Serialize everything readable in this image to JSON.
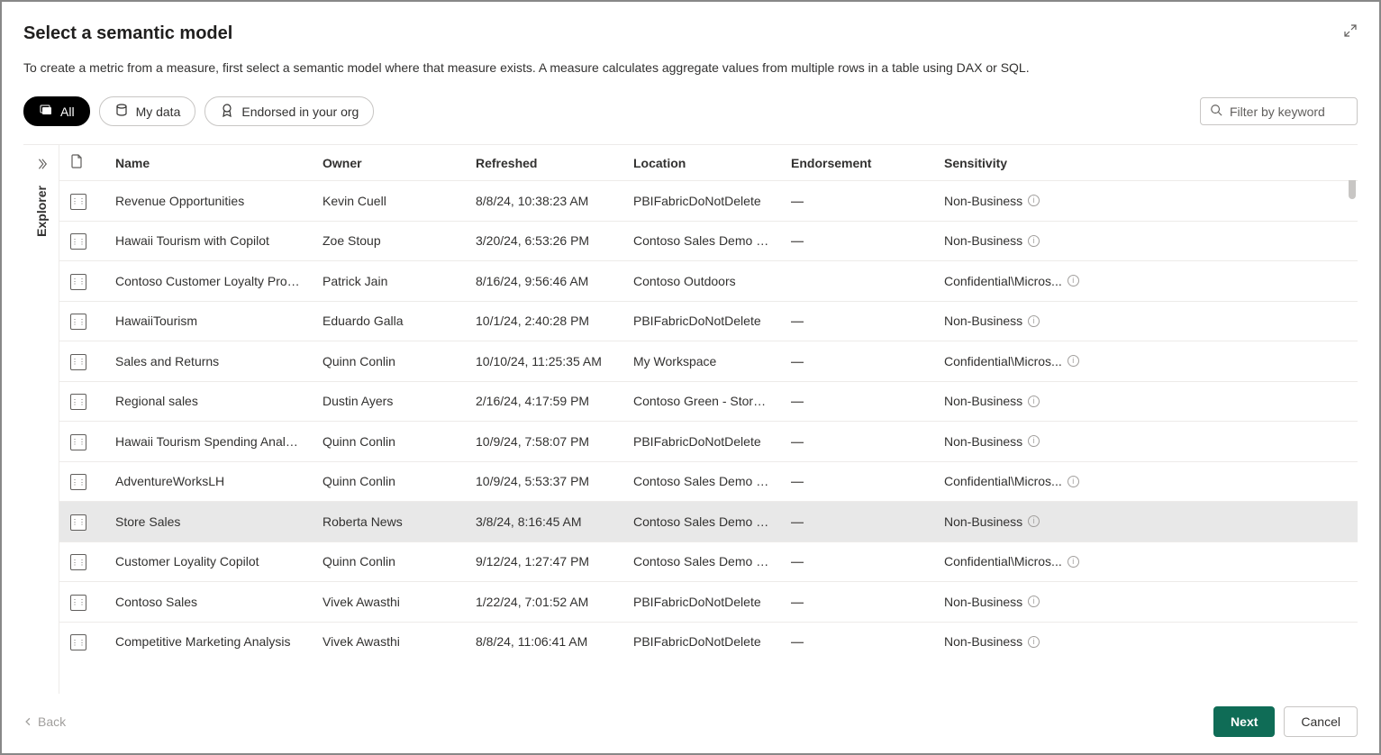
{
  "header": {
    "title": "Select a semantic model",
    "description": "To create a metric from a measure, first select a semantic model where that measure exists. A measure calculates aggregate values from multiple rows in a table using DAX or SQL."
  },
  "filters": {
    "all": "All",
    "my_data": "My data",
    "endorsed": "Endorsed in your org"
  },
  "search": {
    "placeholder": "Filter by keyword"
  },
  "side": {
    "label": "Explorer"
  },
  "columns": {
    "name": "Name",
    "owner": "Owner",
    "refreshed": "Refreshed",
    "location": "Location",
    "endorsement": "Endorsement",
    "sensitivity": "Sensitivity"
  },
  "rows": [
    {
      "name": "Revenue Opportunities",
      "owner": "Kevin Cuell",
      "refreshed": "8/8/24, 10:38:23 AM",
      "location": "PBIFabricDoNotDelete",
      "endorsement": "—",
      "sensitivity": "Non-Business",
      "selected": false
    },
    {
      "name": "Hawaii Tourism with Copilot",
      "owner": "Zoe Stoup",
      "refreshed": "3/20/24, 6:53:26 PM",
      "location": "Contoso Sales Demo Sp...",
      "endorsement": "—",
      "sensitivity": "Non-Business",
      "selected": false
    },
    {
      "name": "Contoso Customer Loyalty Progr...",
      "owner": "Patrick Jain",
      "refreshed": "8/16/24, 9:56:46 AM",
      "location": "Contoso Outdoors",
      "endorsement": "",
      "sensitivity": "Confidential\\Micros...",
      "selected": false
    },
    {
      "name": "HawaiiTourism",
      "owner": "Eduardo Galla",
      "refreshed": "10/1/24, 2:40:28 PM",
      "location": "PBIFabricDoNotDelete",
      "endorsement": "—",
      "sensitivity": "Non-Business",
      "selected": false
    },
    {
      "name": "Sales and Returns",
      "owner": "Quinn Conlin",
      "refreshed": "10/10/24, 11:25:35 AM",
      "location": "My Workspace",
      "endorsement": "—",
      "sensitivity": "Confidential\\Micros...",
      "selected": false
    },
    {
      "name": "Regional sales",
      "owner": "Dustin Ayers",
      "refreshed": "2/16/24, 4:17:59 PM",
      "location": "Contoso Green - Stores ...",
      "endorsement": "—",
      "sensitivity": "Non-Business",
      "selected": false
    },
    {
      "name": "Hawaii Tourism Spending Analysis",
      "owner": "Quinn Conlin",
      "refreshed": "10/9/24, 7:58:07 PM",
      "location": "PBIFabricDoNotDelete",
      "endorsement": "—",
      "sensitivity": "Non-Business",
      "selected": false
    },
    {
      "name": "AdventureWorksLH",
      "owner": "Quinn Conlin",
      "refreshed": "10/9/24, 5:53:37 PM",
      "location": "Contoso Sales Demo Sp...",
      "endorsement": "—",
      "sensitivity": "Confidential\\Micros...",
      "selected": false
    },
    {
      "name": "Store Sales",
      "owner": "Roberta News",
      "refreshed": "3/8/24, 8:16:45 AM",
      "location": "Contoso Sales Demo Sp...",
      "endorsement": "—",
      "sensitivity": "Non-Business",
      "selected": true
    },
    {
      "name": "Customer Loyality Copilot",
      "owner": "Quinn Conlin",
      "refreshed": "9/12/24, 1:27:47 PM",
      "location": "Contoso Sales Demo Sp...",
      "endorsement": "—",
      "sensitivity": "Confidential\\Micros...",
      "selected": false
    },
    {
      "name": "Contoso Sales",
      "owner": "Vivek Awasthi",
      "refreshed": "1/22/24, 7:01:52 AM",
      "location": "PBIFabricDoNotDelete",
      "endorsement": "—",
      "sensitivity": "Non-Business",
      "selected": false
    },
    {
      "name": "Competitive Marketing Analysis",
      "owner": "Vivek Awasthi",
      "refreshed": "8/8/24, 11:06:41 AM",
      "location": "PBIFabricDoNotDelete",
      "endorsement": "—",
      "sensitivity": "Non-Business",
      "selected": false
    }
  ],
  "footer": {
    "back": "Back",
    "next": "Next",
    "cancel": "Cancel"
  }
}
